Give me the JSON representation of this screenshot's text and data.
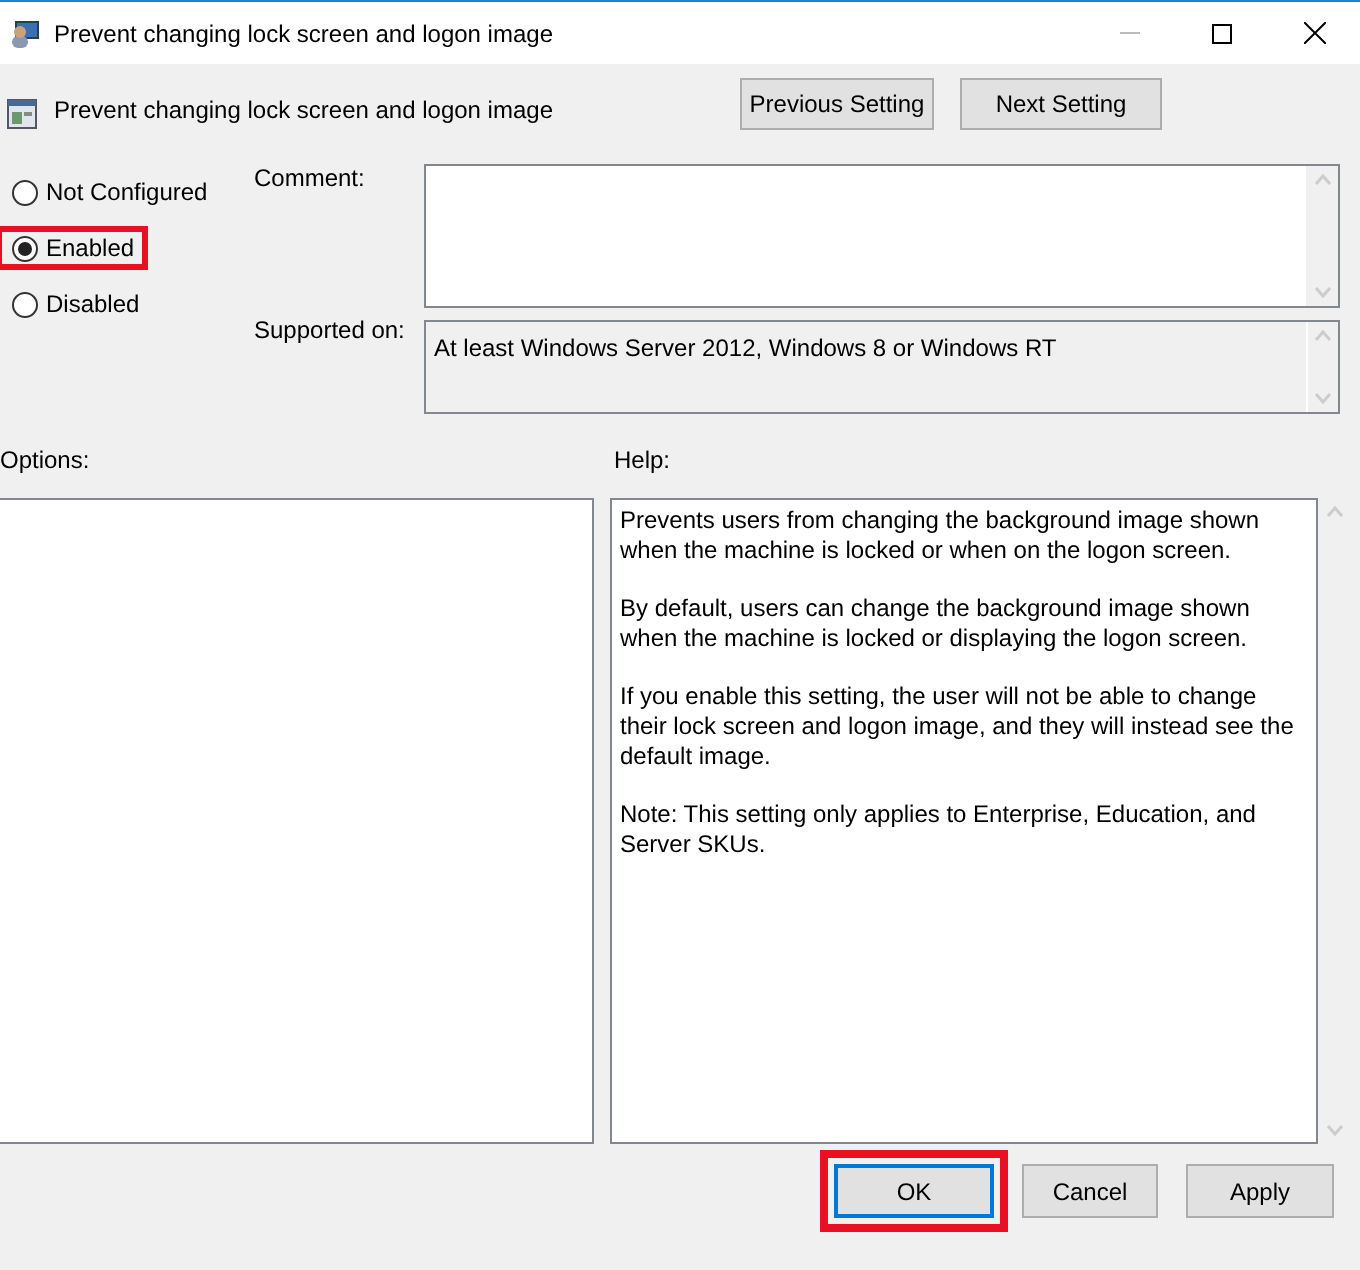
{
  "window": {
    "title": "Prevent changing lock screen and logon image"
  },
  "header": {
    "title": "Prevent changing lock screen and logon image",
    "nav_buttons": [
      "Previous Setting",
      "Next Setting"
    ]
  },
  "state_options": [
    {
      "label": "Not Configured",
      "selected": false,
      "highlighted": false
    },
    {
      "label": "Enabled",
      "selected": true,
      "highlighted": true
    },
    {
      "label": "Disabled",
      "selected": false,
      "highlighted": false
    }
  ],
  "comment": {
    "label": "Comment:"
  },
  "supported_on": {
    "label": "Supported on:",
    "value": "At least Windows Server 2012, Windows 8 or Windows RT"
  },
  "options": {
    "label": "Options:"
  },
  "help": {
    "label": "Help:",
    "paragraphs": [
      "Prevents users from changing the background image shown when the machine is locked or when on the logon screen.",
      "By default, users can change the background image shown when the machine is locked or displaying the logon screen.",
      "If you enable this setting, the user will not be able to change their lock screen and logon image, and they will instead see the default image.",
      "Note: This setting only applies to Enterprise, Education, and Server SKUs."
    ]
  },
  "buttons": [
    {
      "label": "OK",
      "focused": true,
      "highlighted": true
    },
    {
      "label": "Cancel",
      "focused": false,
      "highlighted": false
    },
    {
      "label": "Apply",
      "focused": false,
      "highlighted": false
    }
  ]
}
